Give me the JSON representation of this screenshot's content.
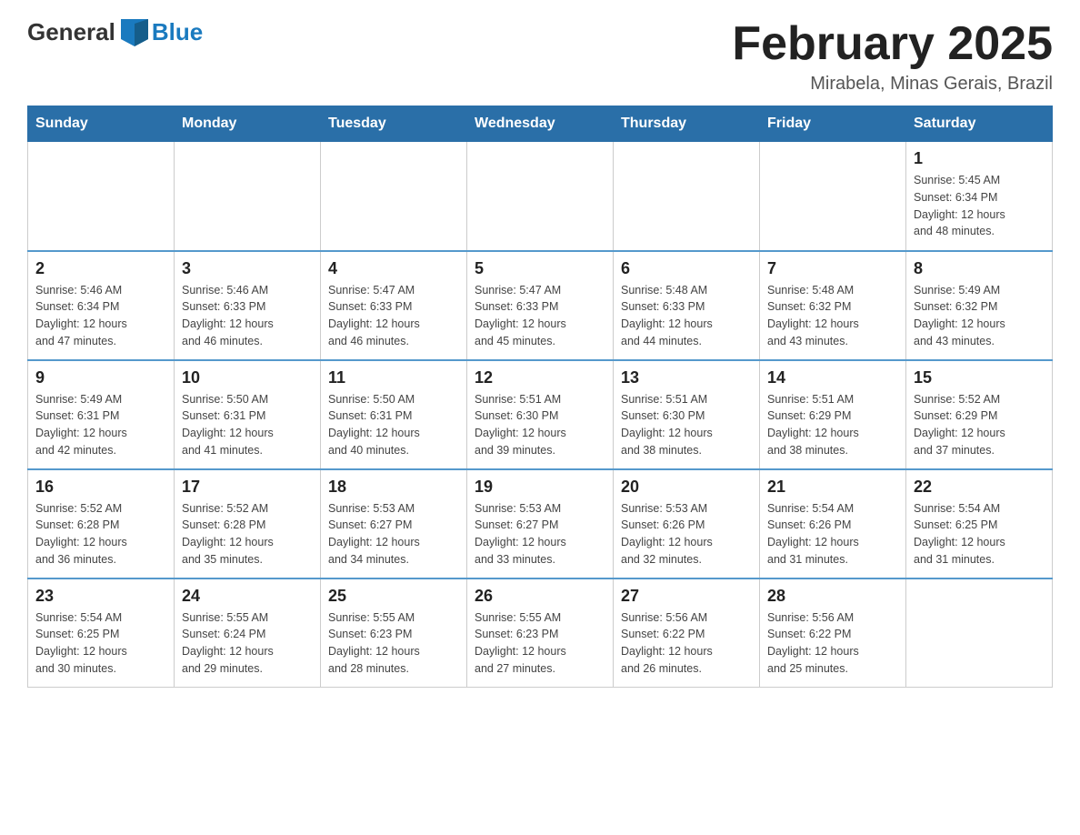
{
  "logo": {
    "text_general": "General",
    "text_blue": "Blue"
  },
  "title": "February 2025",
  "subtitle": "Mirabela, Minas Gerais, Brazil",
  "days_of_week": [
    "Sunday",
    "Monday",
    "Tuesday",
    "Wednesday",
    "Thursday",
    "Friday",
    "Saturday"
  ],
  "weeks": [
    [
      {
        "day": "",
        "info": ""
      },
      {
        "day": "",
        "info": ""
      },
      {
        "day": "",
        "info": ""
      },
      {
        "day": "",
        "info": ""
      },
      {
        "day": "",
        "info": ""
      },
      {
        "day": "",
        "info": ""
      },
      {
        "day": "1",
        "info": "Sunrise: 5:45 AM\nSunset: 6:34 PM\nDaylight: 12 hours\nand 48 minutes."
      }
    ],
    [
      {
        "day": "2",
        "info": "Sunrise: 5:46 AM\nSunset: 6:34 PM\nDaylight: 12 hours\nand 47 minutes."
      },
      {
        "day": "3",
        "info": "Sunrise: 5:46 AM\nSunset: 6:33 PM\nDaylight: 12 hours\nand 46 minutes."
      },
      {
        "day": "4",
        "info": "Sunrise: 5:47 AM\nSunset: 6:33 PM\nDaylight: 12 hours\nand 46 minutes."
      },
      {
        "day": "5",
        "info": "Sunrise: 5:47 AM\nSunset: 6:33 PM\nDaylight: 12 hours\nand 45 minutes."
      },
      {
        "day": "6",
        "info": "Sunrise: 5:48 AM\nSunset: 6:33 PM\nDaylight: 12 hours\nand 44 minutes."
      },
      {
        "day": "7",
        "info": "Sunrise: 5:48 AM\nSunset: 6:32 PM\nDaylight: 12 hours\nand 43 minutes."
      },
      {
        "day": "8",
        "info": "Sunrise: 5:49 AM\nSunset: 6:32 PM\nDaylight: 12 hours\nand 43 minutes."
      }
    ],
    [
      {
        "day": "9",
        "info": "Sunrise: 5:49 AM\nSunset: 6:31 PM\nDaylight: 12 hours\nand 42 minutes."
      },
      {
        "day": "10",
        "info": "Sunrise: 5:50 AM\nSunset: 6:31 PM\nDaylight: 12 hours\nand 41 minutes."
      },
      {
        "day": "11",
        "info": "Sunrise: 5:50 AM\nSunset: 6:31 PM\nDaylight: 12 hours\nand 40 minutes."
      },
      {
        "day": "12",
        "info": "Sunrise: 5:51 AM\nSunset: 6:30 PM\nDaylight: 12 hours\nand 39 minutes."
      },
      {
        "day": "13",
        "info": "Sunrise: 5:51 AM\nSunset: 6:30 PM\nDaylight: 12 hours\nand 38 minutes."
      },
      {
        "day": "14",
        "info": "Sunrise: 5:51 AM\nSunset: 6:29 PM\nDaylight: 12 hours\nand 38 minutes."
      },
      {
        "day": "15",
        "info": "Sunrise: 5:52 AM\nSunset: 6:29 PM\nDaylight: 12 hours\nand 37 minutes."
      }
    ],
    [
      {
        "day": "16",
        "info": "Sunrise: 5:52 AM\nSunset: 6:28 PM\nDaylight: 12 hours\nand 36 minutes."
      },
      {
        "day": "17",
        "info": "Sunrise: 5:52 AM\nSunset: 6:28 PM\nDaylight: 12 hours\nand 35 minutes."
      },
      {
        "day": "18",
        "info": "Sunrise: 5:53 AM\nSunset: 6:27 PM\nDaylight: 12 hours\nand 34 minutes."
      },
      {
        "day": "19",
        "info": "Sunrise: 5:53 AM\nSunset: 6:27 PM\nDaylight: 12 hours\nand 33 minutes."
      },
      {
        "day": "20",
        "info": "Sunrise: 5:53 AM\nSunset: 6:26 PM\nDaylight: 12 hours\nand 32 minutes."
      },
      {
        "day": "21",
        "info": "Sunrise: 5:54 AM\nSunset: 6:26 PM\nDaylight: 12 hours\nand 31 minutes."
      },
      {
        "day": "22",
        "info": "Sunrise: 5:54 AM\nSunset: 6:25 PM\nDaylight: 12 hours\nand 31 minutes."
      }
    ],
    [
      {
        "day": "23",
        "info": "Sunrise: 5:54 AM\nSunset: 6:25 PM\nDaylight: 12 hours\nand 30 minutes."
      },
      {
        "day": "24",
        "info": "Sunrise: 5:55 AM\nSunset: 6:24 PM\nDaylight: 12 hours\nand 29 minutes."
      },
      {
        "day": "25",
        "info": "Sunrise: 5:55 AM\nSunset: 6:23 PM\nDaylight: 12 hours\nand 28 minutes."
      },
      {
        "day": "26",
        "info": "Sunrise: 5:55 AM\nSunset: 6:23 PM\nDaylight: 12 hours\nand 27 minutes."
      },
      {
        "day": "27",
        "info": "Sunrise: 5:56 AM\nSunset: 6:22 PM\nDaylight: 12 hours\nand 26 minutes."
      },
      {
        "day": "28",
        "info": "Sunrise: 5:56 AM\nSunset: 6:22 PM\nDaylight: 12 hours\nand 25 minutes."
      },
      {
        "day": "",
        "info": ""
      }
    ]
  ]
}
